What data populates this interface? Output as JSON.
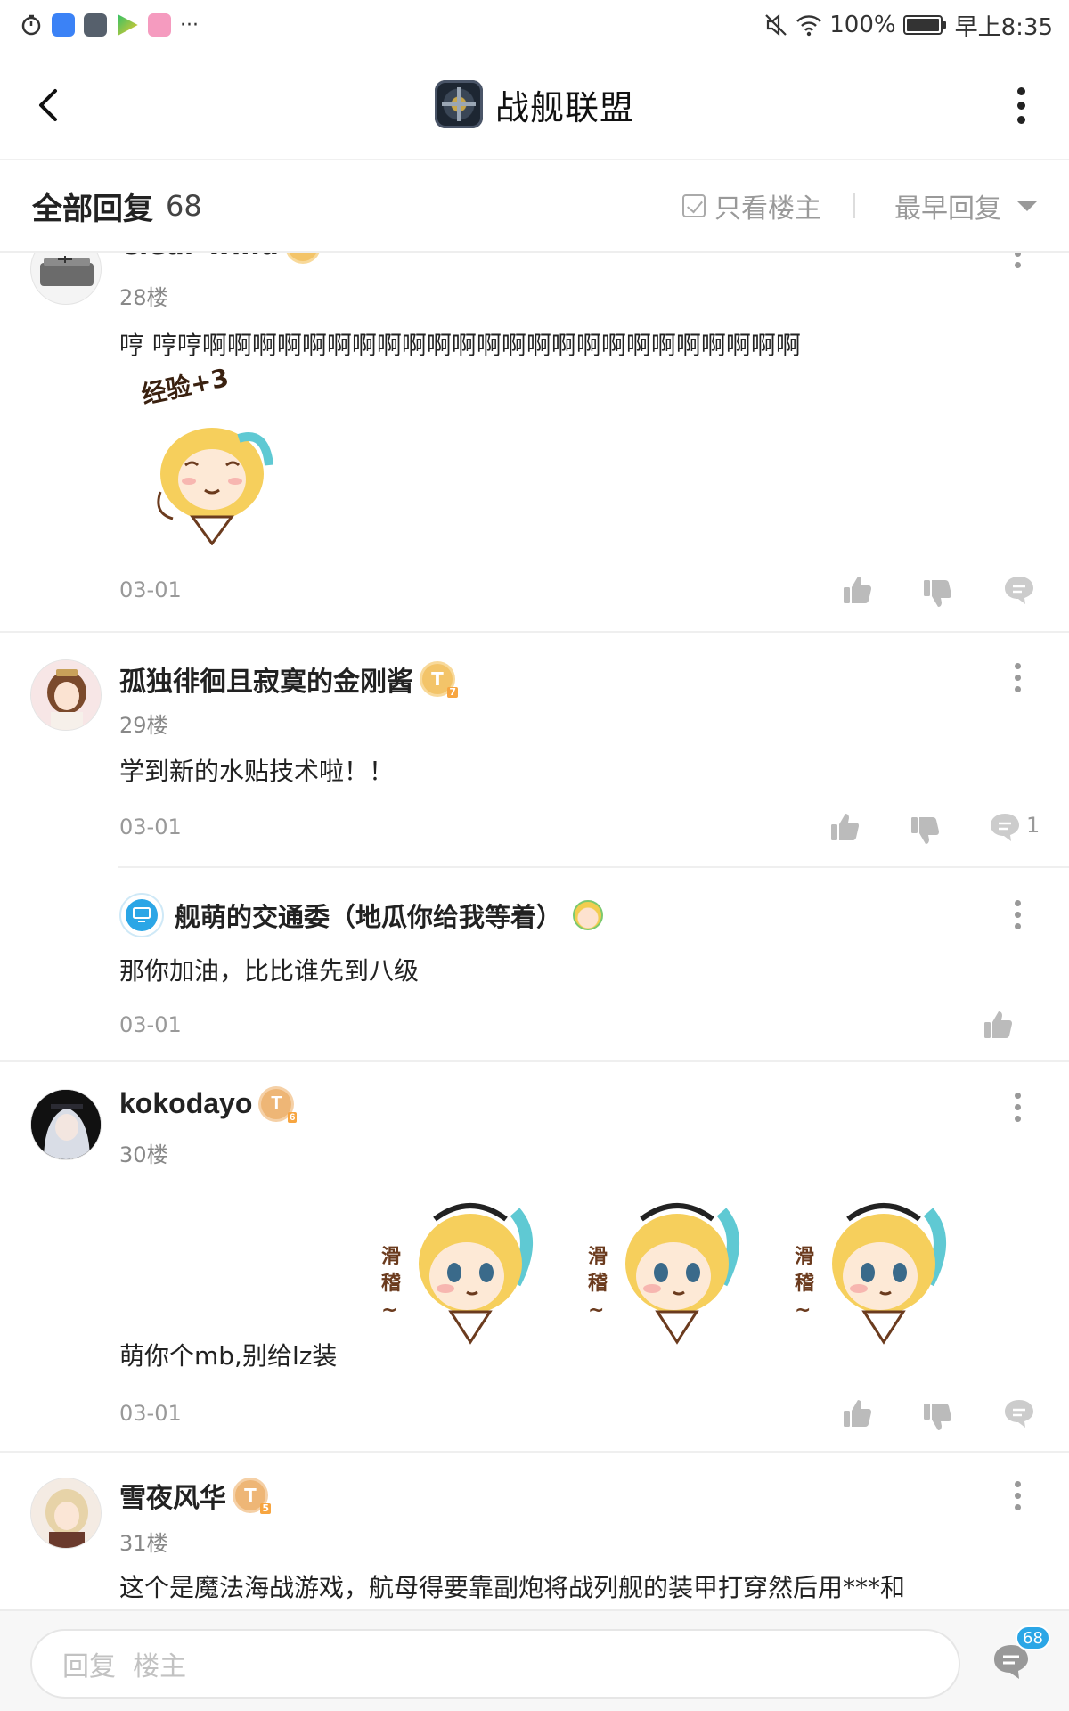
{
  "statusbar": {
    "battery": "100%",
    "time": "早上8:35",
    "more": "···"
  },
  "header": {
    "title": "战舰联盟",
    "forum_logo_icon": "warship-emblem-icon"
  },
  "filter": {
    "all_replies": "全部回复",
    "count": "68",
    "only_op": "只看楼主",
    "sort": "最早回复"
  },
  "posts": [
    {
      "user": "Clear wind",
      "floor": "28楼",
      "text": "哼 哼哼啊啊啊啊啊啊啊啊啊啊啊啊啊啊啊啊啊啊啊啊啊啊啊啊",
      "sticker_text": "经验+3",
      "date": "03-01"
    },
    {
      "user": "孤独徘徊且寂寞的金刚酱",
      "floor": "29楼",
      "text": "学到新的水贴技术啦！！",
      "date": "03-01",
      "comment_count": "1",
      "sub_reply": {
        "user": "舰萌的交通委（地瓜你给我等着）",
        "text": "那你加油，比比谁先到八级",
        "date": "03-01"
      }
    },
    {
      "user": "kokodayo",
      "floor": "30楼",
      "text": "萌你个mb,别给lz装",
      "sticker_text": "滑稽~",
      "date": "03-01"
    },
    {
      "user": "雪夜风华",
      "floor": "31楼",
      "text": "这个是魔法海战游戏，航母得要靠副炮将战列舰的装甲打穿然后用***和"
    }
  ],
  "reply_bar": {
    "placeholder": "回复  楼主",
    "badge": "68"
  },
  "colors": {
    "level_badge": "#f3c469",
    "accent_blue": "#2ba6e6",
    "text_gray": "#999999"
  }
}
